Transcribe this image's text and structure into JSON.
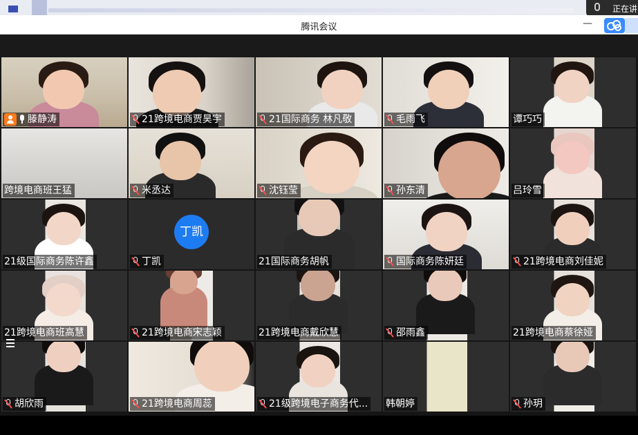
{
  "window": {
    "title": "腾讯会议"
  },
  "status": {
    "speaking_label": "正在讲"
  },
  "participants": [
    {
      "name": "滕静涛",
      "mic": "on",
      "host": true
    },
    {
      "name": "21跨境电商贾昊宇",
      "mic": "muted"
    },
    {
      "name": "21国际商务 林凡敬",
      "mic": "muted"
    },
    {
      "name": "毛雨飞",
      "mic": "muted"
    },
    {
      "name": "谭巧巧",
      "mic": "none"
    },
    {
      "name": "跨境电商班王猛",
      "mic": "none"
    },
    {
      "name": "米丞达",
      "mic": "muted"
    },
    {
      "name": "沈钰莹",
      "mic": "muted"
    },
    {
      "name": "孙东清",
      "mic": "muted"
    },
    {
      "name": "吕玲雪",
      "mic": "none"
    },
    {
      "name": "21级国际商务陈许鑫",
      "mic": "none"
    },
    {
      "name": "丁凯",
      "mic": "muted",
      "avatar": "丁凯"
    },
    {
      "name": "21国际商务胡帆",
      "mic": "none"
    },
    {
      "name": "国际商务陈妍廷",
      "mic": "muted"
    },
    {
      "name": "21跨境电商刘佳妮",
      "mic": "muted"
    },
    {
      "name": "21跨境电商班高慧",
      "mic": "none"
    },
    {
      "name": "21跨境电商宋志颖",
      "mic": "muted"
    },
    {
      "name": "21跨境电商戴欣慧",
      "mic": "none"
    },
    {
      "name": "邵雨鑫",
      "mic": "muted"
    },
    {
      "name": "21跨境电商蔡徐娅",
      "mic": "none"
    },
    {
      "name": "胡欣雨",
      "mic": "muted"
    },
    {
      "name": "21跨境电商周蕊",
      "mic": "muted"
    },
    {
      "name": "21级跨境电子商务代...",
      "mic": "muted"
    },
    {
      "name": "韩朝婷",
      "mic": "none"
    },
    {
      "name": "孙玥",
      "mic": "muted"
    }
  ],
  "icons": {
    "minimize": "minimize-icon",
    "app": "tencent-meeting-cloud-icon",
    "host": "host-badge-icon",
    "mic_on": "microphone-icon",
    "mic_muted": "microphone-muted-icon",
    "list": "list-icon"
  },
  "colors": {
    "active_speaker_border": "#2ecc71",
    "host_badge": "#ff7a1a",
    "avatar_bg": "#1e7cf2",
    "app_accent": "#3a8bff"
  }
}
